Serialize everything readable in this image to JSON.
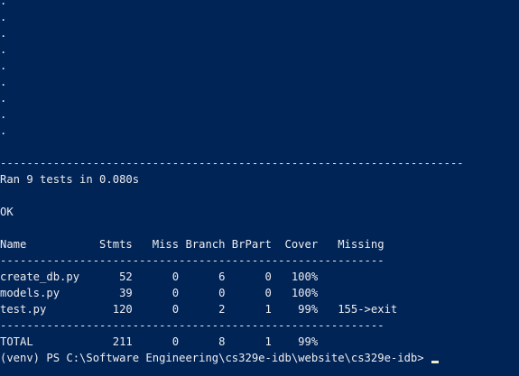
{
  "terminal": {
    "background": "#012456",
    "foreground": "#eeedf0",
    "dots": [
      ".",
      ".",
      ".",
      ".",
      ".",
      ".",
      ".",
      ".",
      "."
    ],
    "separator_long": "----------------------------------------------------------------------",
    "ran_line": "Ran 9 tests in 0.080s",
    "ok_line": "OK",
    "coverage": {
      "header": "Name           Stmts   Miss Branch BrPart  Cover   Missing",
      "separator": "----------------------------------------------------------",
      "rows": [
        "create_db.py      52      0      6      0   100%",
        "models.py         39      0      0      0   100%",
        "test.py          120      0      2      1    99%   155->exit"
      ],
      "separator2": "----------------------------------------------------------",
      "total": "TOTAL            211      0      8      1    99%"
    },
    "prompt": "(venv) PS C:\\Software Engineering\\cs329e-idb\\website\\cs329e-idb>"
  }
}
